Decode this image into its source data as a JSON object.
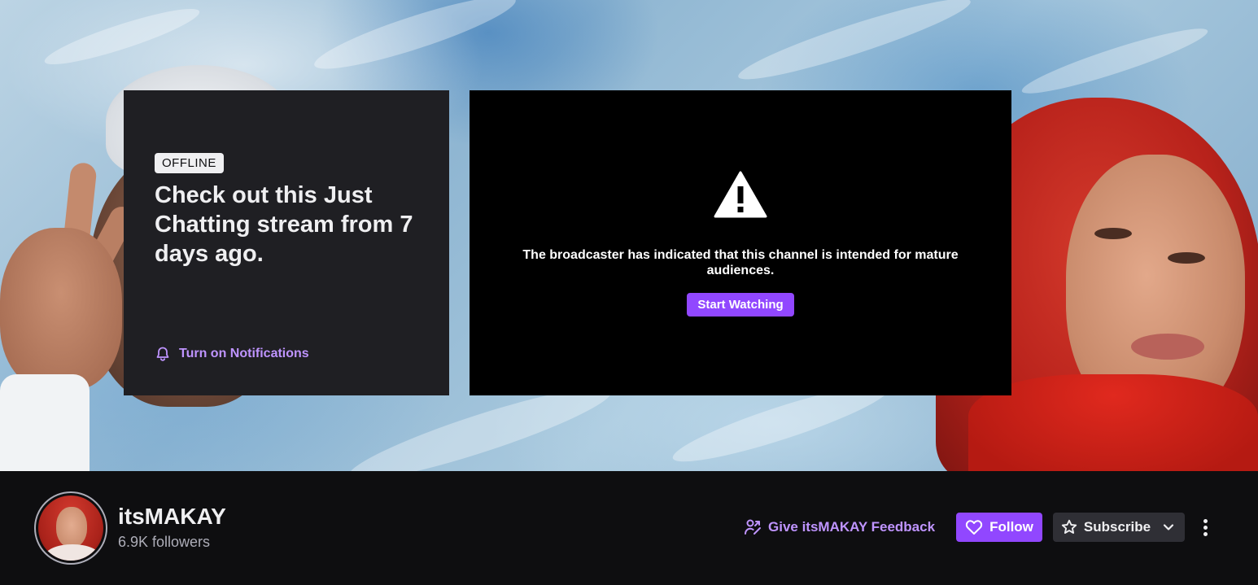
{
  "offline_card": {
    "badge": "OFFLINE",
    "headline": "Check out this Just Chatting stream from 7 days ago.",
    "notify_label": "Turn on Notifications"
  },
  "player": {
    "mature_message": "The broadcaster has indicated that this channel is intended for mature audiences.",
    "start_label": "Start Watching"
  },
  "channel": {
    "name": "itsMAKAY",
    "followers": "6.9K followers",
    "feedback_label": "Give itsMAKAY Feedback",
    "follow_label": "Follow",
    "subscribe_label": "Subscribe"
  },
  "icons": {
    "notification": "bell-icon",
    "warning": "warning-triangle-icon",
    "feedback": "feedback-person-icon",
    "follow": "heart-icon",
    "subscribe": "star-icon",
    "dropdown": "chevron-down-icon",
    "more": "more-vertical-icon"
  },
  "colors": {
    "accent": "#9147ff",
    "accent_text": "#bf94ff",
    "background": "#0e0e10",
    "card": "#1f1f23",
    "subscribe_bg": "#2f2f35"
  }
}
